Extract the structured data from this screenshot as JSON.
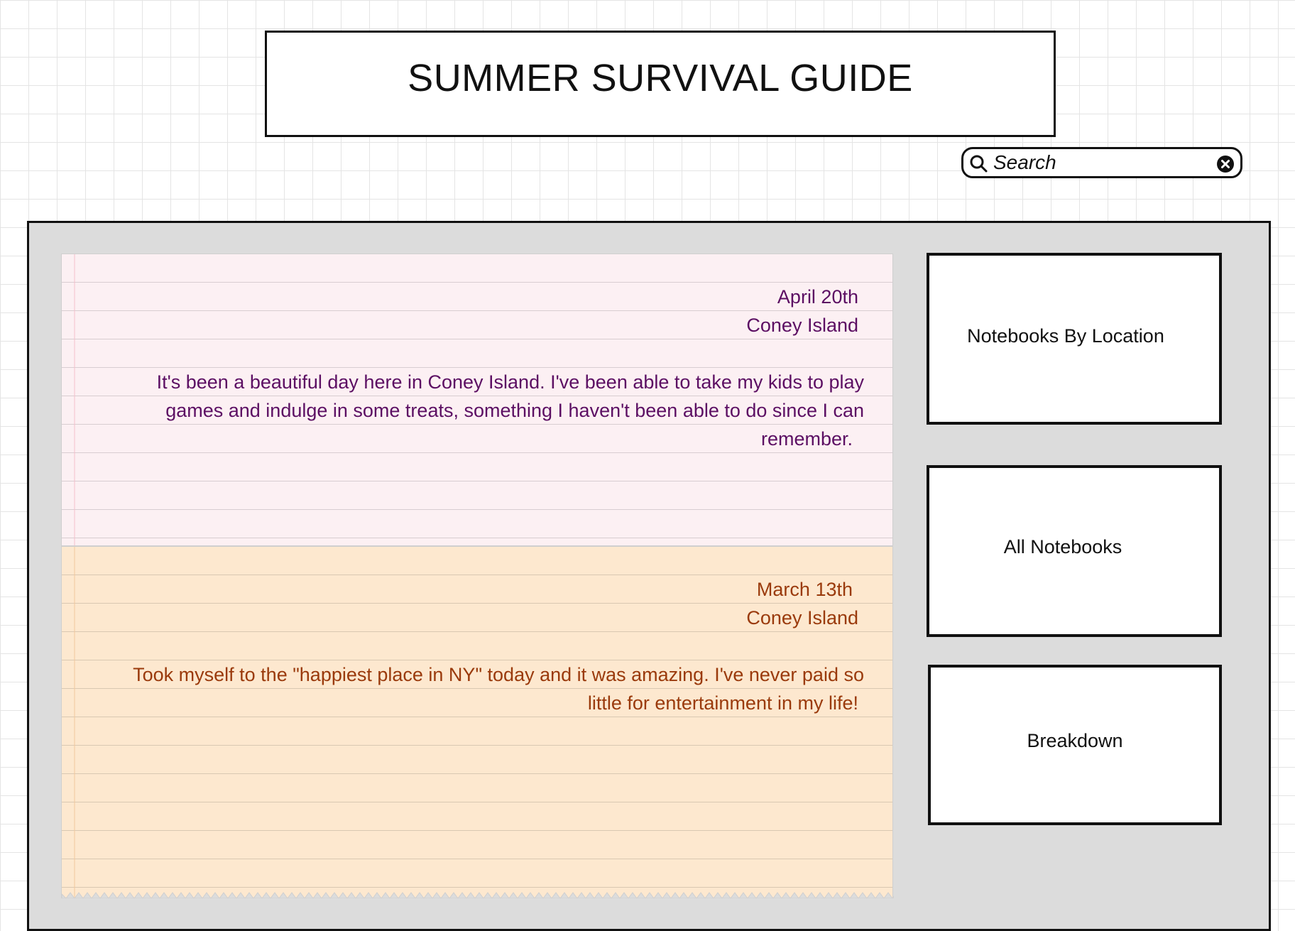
{
  "header": {
    "title": "SUMMER SURVIVAL GUIDE"
  },
  "search": {
    "placeholder": "Search",
    "value": "",
    "search_icon": "search-icon",
    "clear_icon": "clear-icon"
  },
  "notes": [
    {
      "date": "April 20th",
      "location": "Coney Island",
      "body_lines": [
        "It's been a beautiful day here in Coney Island. I've been able to take my kids to play",
        "games and indulge in some treats, something I haven't been able to do since I can",
        "remember."
      ],
      "color": "#5c0f63",
      "background": "#fcf0f3"
    },
    {
      "date": "March 13th",
      "location": "Coney Island",
      "body_lines": [
        "Took myself to the \"happiest place in NY\" today and it was amazing. I've never paid so",
        "little for entertainment in my life!"
      ],
      "color": "#9a3a0c",
      "background": "#fde8cf"
    }
  ],
  "sidebar": {
    "buttons": [
      {
        "label": "Notebooks By Location"
      },
      {
        "label": "All Notebooks"
      },
      {
        "label": "Breakdown"
      }
    ]
  }
}
